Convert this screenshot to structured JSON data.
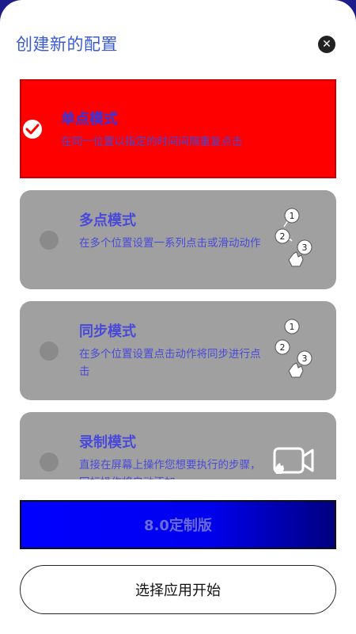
{
  "header": {
    "title": "创建新的配置"
  },
  "modes": [
    {
      "title": "单点模式",
      "desc": "在同一位置以指定的时间间隔重复点击",
      "selected": true
    },
    {
      "title": "多点模式",
      "desc": "在多个位置设置一系列点击或滑动动作",
      "icon": "multi-tap-icon"
    },
    {
      "title": "同步模式",
      "desc": "在多个位置设置点击动作将同步进行点击",
      "icon": "sync-tap-icon"
    },
    {
      "title": "录制模式",
      "desc": "直接在屏幕上操作您想要执行的步骤，回标操作将自动添加",
      "icon": "record-icon"
    }
  ],
  "icon_numbers": [
    "1",
    "2",
    "3"
  ],
  "footer": {
    "version_label": "8.0定制版",
    "start_label": "选择应用开始"
  },
  "colors": {
    "selected_card": "#ff0000",
    "card": "#a0a0a0",
    "title_blue": "#3b5bd0",
    "version_button": "#0000ff"
  }
}
